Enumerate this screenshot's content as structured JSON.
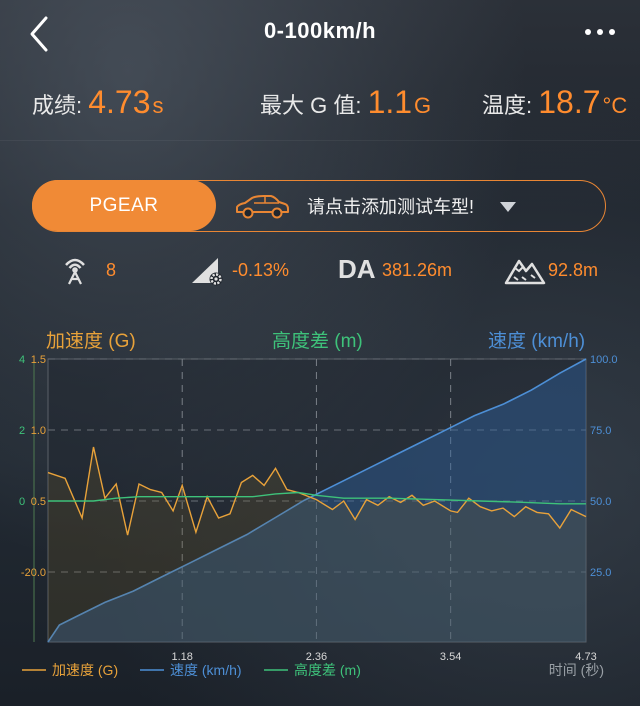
{
  "header": {
    "title": "0-100km/h"
  },
  "stats": [
    {
      "label": "成绩: ",
      "value": "4.73",
      "unit": "s"
    },
    {
      "label": "最大 G 值: ",
      "value": "1.1",
      "unit": "G"
    },
    {
      "label": "温度: ",
      "value": "18.7",
      "unit": "°C"
    }
  ],
  "vehicle": {
    "brand": "PGEAR",
    "select_prompt": "请点击添加测试车型!"
  },
  "info": {
    "satellites": "8",
    "slope": "-0.13%",
    "da_label": "DA",
    "da_value": "381.26m",
    "altitude": "92.8m"
  },
  "colors": {
    "accent": "#ff8c2e",
    "accel": "#e8a23a",
    "speed": "#4d8fd6",
    "altitude": "#3ec27a"
  },
  "chart_data": {
    "type": "line",
    "headers": {
      "left": "加速度 (G)",
      "middle": "高度差 (m)",
      "right": "速度 (km/h)"
    },
    "x_ticks": [
      "1.18",
      "2.36",
      "3.54",
      "4.73"
    ],
    "x_max": 4.73,
    "xlabel": "时间 (秒)",
    "axis_left_outer": {
      "ticks": [
        "4",
        "2",
        "0"
      ]
    },
    "axis_left_inner": {
      "ticks": [
        "1.5",
        "1.0",
        "0.5",
        "-20.0"
      ]
    },
    "axis_right": {
      "ticks": [
        "100.0",
        "75.0",
        "50.0",
        "25.0"
      ],
      "ylim": [
        0,
        100
      ]
    },
    "legend": [
      "加速度 (G)",
      "速度 (km/h)",
      "高度差 (m)"
    ],
    "series": [
      {
        "name": "速度 (km/h)",
        "axis": "right",
        "x": [
          0,
          0.1,
          0.25,
          0.5,
          0.75,
          1.0,
          1.25,
          1.5,
          1.75,
          2.0,
          2.25,
          2.5,
          2.75,
          3.0,
          3.25,
          3.5,
          3.75,
          4.0,
          4.25,
          4.5,
          4.73
        ],
        "values": [
          0,
          6,
          9,
          14,
          18,
          23,
          28,
          33,
          38,
          44,
          50,
          55,
          60,
          65,
          70,
          75,
          80,
          84,
          89,
          95,
          100
        ]
      },
      {
        "name": "加速度 (G)",
        "axis": "left",
        "x": [
          0,
          0.15,
          0.3,
          0.4,
          0.5,
          0.6,
          0.7,
          0.8,
          0.9,
          1.0,
          1.1,
          1.18,
          1.3,
          1.4,
          1.5,
          1.6,
          1.7,
          1.8,
          1.9,
          2.0,
          2.1,
          2.2,
          2.36,
          2.5,
          2.6,
          2.7,
          2.8,
          2.9,
          3.0,
          3.1,
          3.2,
          3.3,
          3.4,
          3.54,
          3.6,
          3.7,
          3.8,
          3.9,
          4.0,
          4.1,
          4.2,
          4.3,
          4.4,
          4.5,
          4.6,
          4.73
        ],
        "values": [
          0.7,
          0.66,
          0.38,
          0.88,
          0.52,
          0.62,
          0.26,
          0.62,
          0.58,
          0.56,
          0.43,
          0.61,
          0.28,
          0.53,
          0.38,
          0.41,
          0.63,
          0.68,
          0.61,
          0.73,
          0.58,
          0.56,
          0.51,
          0.44,
          0.5,
          0.37,
          0.51,
          0.47,
          0.53,
          0.49,
          0.54,
          0.47,
          0.5,
          0.43,
          0.42,
          0.52,
          0.46,
          0.43,
          0.45,
          0.39,
          0.46,
          0.42,
          0.41,
          0.31,
          0.44,
          0.39
        ]
      },
      {
        "name": "高度差 (m)",
        "axis": "left",
        "x": [
          0,
          0.4,
          0.6,
          0.8,
          1.0,
          1.4,
          1.8,
          2.0,
          2.2,
          2.36,
          2.6,
          3.0,
          3.4,
          3.8,
          4.2,
          4.5,
          4.73
        ],
        "values": [
          0.5,
          0.5,
          0.52,
          0.53,
          0.53,
          0.53,
          0.53,
          0.55,
          0.56,
          0.54,
          0.52,
          0.52,
          0.51,
          0.5,
          0.49,
          0.48,
          0.48
        ]
      }
    ]
  }
}
